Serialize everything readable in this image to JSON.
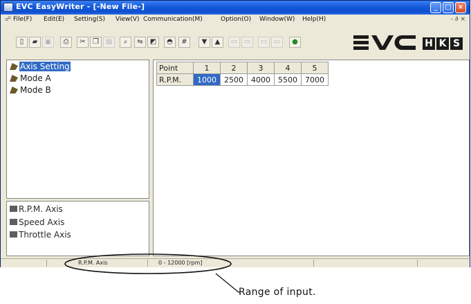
{
  "window": {
    "title": "EVC EasyWriter - [-New File-]"
  },
  "menu": {
    "items": [
      "File(F)",
      "Edit(E)",
      "Setting(S)",
      "View(V)",
      "Communication(M)",
      "Option(O)",
      "Window(W)",
      "Help(H)"
    ],
    "mdi_controls": "- ∂ ×"
  },
  "toolbar": {
    "logo_text": "EVC",
    "brand_letters": [
      "H",
      "K",
      "S"
    ]
  },
  "tree": {
    "items": [
      "Axis Setting",
      "Mode A",
      "Mode B"
    ],
    "selected": "Axis Setting"
  },
  "axes": {
    "items": [
      "R.P.M. Axis",
      "Speed Axis",
      "Throttle Axis"
    ]
  },
  "grid": {
    "header_label": "Point",
    "columns": [
      "1",
      "2",
      "3",
      "4",
      "5"
    ],
    "row_label": "R.P.M.",
    "values": [
      "1000",
      "2500",
      "4000",
      "5500",
      "7000"
    ],
    "selected_index": 0
  },
  "status": {
    "axis": "R.P.M. Axis",
    "range": "0 - 12000 [rpm]"
  },
  "annotation": {
    "text": "Range of input."
  }
}
